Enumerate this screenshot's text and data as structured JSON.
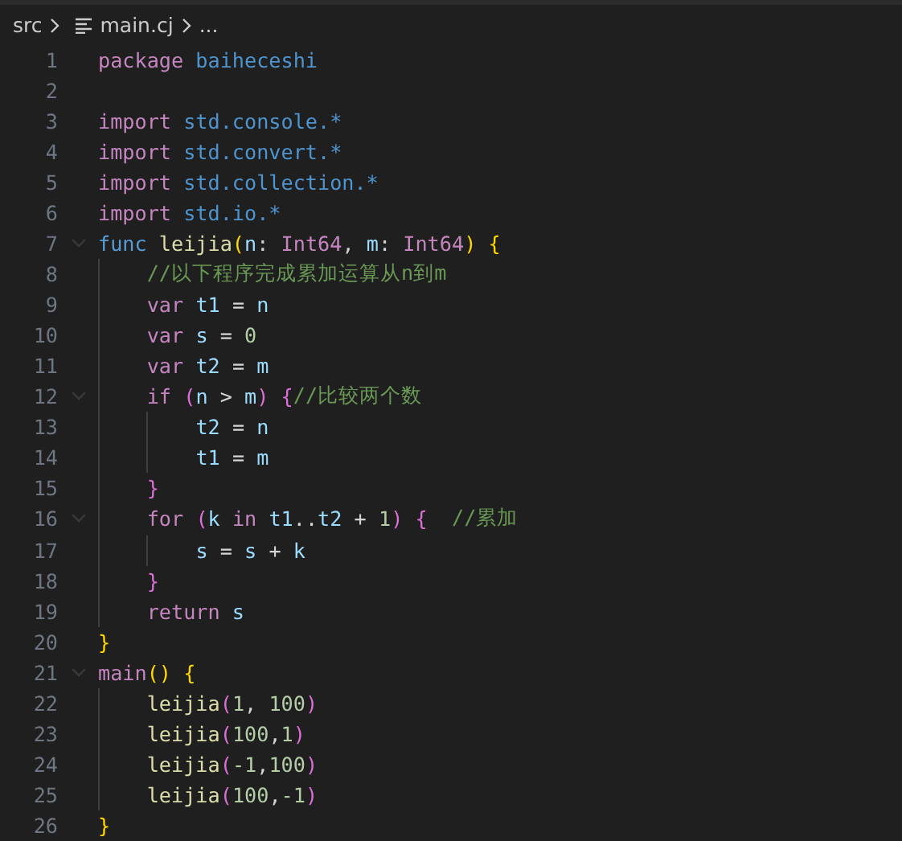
{
  "breadcrumb": {
    "folder": "src",
    "file": "main.cj",
    "more": "..."
  },
  "lines": [
    {
      "number": "1",
      "foldable": false,
      "tokens": [
        {
          "text": "package ",
          "kind": "keyword"
        },
        {
          "text": "baiheceshi",
          "kind": "module"
        }
      ]
    },
    {
      "number": "2",
      "foldable": false
    },
    {
      "number": "3",
      "foldable": false,
      "tokens": [
        {
          "text": "import ",
          "kind": "keyword"
        },
        {
          "text": "std.console.*",
          "kind": "module"
        }
      ]
    },
    {
      "number": "4",
      "foldable": false,
      "tokens": [
        {
          "text": "import ",
          "kind": "keyword"
        },
        {
          "text": "std.convert.*",
          "kind": "module"
        }
      ]
    },
    {
      "number": "5",
      "foldable": false,
      "tokens": [
        {
          "text": "import ",
          "kind": "keyword"
        },
        {
          "text": "std.collection.*",
          "kind": "module"
        }
      ]
    },
    {
      "number": "6",
      "foldable": false,
      "tokens": [
        {
          "text": "import ",
          "kind": "keyword"
        },
        {
          "text": "std.io.*",
          "kind": "module"
        }
      ]
    },
    {
      "number": "7",
      "foldable": true,
      "tokens": [
        {
          "text": "func ",
          "kind": "declaration"
        },
        {
          "text": "leijia",
          "kind": "function"
        },
        {
          "text": "(",
          "kind": "bracket1"
        },
        {
          "text": "n",
          "kind": "variable"
        },
        {
          "text": ": ",
          "kind": "plain"
        },
        {
          "text": "Int64",
          "kind": "type"
        },
        {
          "text": ", ",
          "kind": "plain"
        },
        {
          "text": "m",
          "kind": "variable"
        },
        {
          "text": ": ",
          "kind": "plain"
        },
        {
          "text": "Int64",
          "kind": "type"
        },
        {
          "text": ") {",
          "kind": "bracket1"
        }
      ]
    },
    {
      "number": "8",
      "foldable": false,
      "tokens": [
        {
          "text": "    //以下程序完成累加运算从n到m",
          "kind": "comment"
        }
      ]
    },
    {
      "number": "9",
      "foldable": false,
      "tokens": [
        {
          "text": "    var ",
          "kind": "keyword"
        },
        {
          "text": "t1",
          "kind": "variable"
        },
        {
          "text": " = ",
          "kind": "plain"
        },
        {
          "text": "n",
          "kind": "variable"
        }
      ]
    },
    {
      "number": "10",
      "foldable": false,
      "tokens": [
        {
          "text": "    var ",
          "kind": "keyword"
        },
        {
          "text": "s",
          "kind": "variable"
        },
        {
          "text": " = ",
          "kind": "plain"
        },
        {
          "text": "0",
          "kind": "number"
        }
      ]
    },
    {
      "number": "11",
      "foldable": false,
      "tokens": [
        {
          "text": "    var ",
          "kind": "keyword"
        },
        {
          "text": "t2",
          "kind": "variable"
        },
        {
          "text": " = ",
          "kind": "plain"
        },
        {
          "text": "m",
          "kind": "variable"
        }
      ]
    },
    {
      "number": "12",
      "foldable": true,
      "tokens": [
        {
          "text": "    if ",
          "kind": "keyword"
        },
        {
          "text": "(",
          "kind": "bracket2"
        },
        {
          "text": "n",
          "kind": "variable"
        },
        {
          "text": " > ",
          "kind": "plain"
        },
        {
          "text": "m",
          "kind": "variable"
        },
        {
          "text": ") {",
          "kind": "bracket2"
        },
        {
          "text": "//比较两个数",
          "kind": "comment"
        }
      ]
    },
    {
      "number": "13",
      "foldable": false,
      "tokens": [
        {
          "text": "        t2",
          "kind": "variable"
        },
        {
          "text": " = ",
          "kind": "plain"
        },
        {
          "text": "n",
          "kind": "variable"
        }
      ]
    },
    {
      "number": "14",
      "foldable": false,
      "tokens": [
        {
          "text": "        t1",
          "kind": "variable"
        },
        {
          "text": " = ",
          "kind": "plain"
        },
        {
          "text": "m",
          "kind": "variable"
        }
      ]
    },
    {
      "number": "15",
      "foldable": false,
      "tokens": [
        {
          "text": "    }",
          "kind": "bracket2"
        }
      ]
    },
    {
      "number": "16",
      "foldable": true,
      "tokens": [
        {
          "text": "    for ",
          "kind": "keyword"
        },
        {
          "text": "(",
          "kind": "bracket2"
        },
        {
          "text": "k ",
          "kind": "variable"
        },
        {
          "text": "in ",
          "kind": "keyword"
        },
        {
          "text": "t1",
          "kind": "variable"
        },
        {
          "text": "..",
          "kind": "plain"
        },
        {
          "text": "t2",
          "kind": "variable"
        },
        {
          "text": " + ",
          "kind": "plain"
        },
        {
          "text": "1",
          "kind": "number"
        },
        {
          "text": ") {  ",
          "kind": "bracket2"
        },
        {
          "text": "//累加",
          "kind": "comment"
        }
      ]
    },
    {
      "number": "17",
      "foldable": false,
      "tokens": [
        {
          "text": "        s",
          "kind": "variable"
        },
        {
          "text": " = ",
          "kind": "plain"
        },
        {
          "text": "s",
          "kind": "variable"
        },
        {
          "text": " + ",
          "kind": "plain"
        },
        {
          "text": "k",
          "kind": "variable"
        }
      ]
    },
    {
      "number": "18",
      "foldable": false,
      "tokens": [
        {
          "text": "    }",
          "kind": "bracket2"
        }
      ]
    },
    {
      "number": "19",
      "foldable": false,
      "tokens": [
        {
          "text": "    return ",
          "kind": "keyword"
        },
        {
          "text": "s",
          "kind": "variable"
        }
      ]
    },
    {
      "number": "20",
      "foldable": false,
      "tokens": [
        {
          "text": "}",
          "kind": "bracket1"
        }
      ]
    },
    {
      "number": "21",
      "foldable": true,
      "tokens": [
        {
          "text": "main",
          "kind": "keyword"
        },
        {
          "text": "() {",
          "kind": "bracket1"
        }
      ]
    },
    {
      "number": "22",
      "foldable": false,
      "tokens": [
        {
          "text": "    leijia",
          "kind": "function"
        },
        {
          "text": "(",
          "kind": "bracket2"
        },
        {
          "text": "1",
          "kind": "number"
        },
        {
          "text": ", ",
          "kind": "plain"
        },
        {
          "text": "100",
          "kind": "number"
        },
        {
          "text": ")",
          "kind": "bracket2"
        }
      ]
    },
    {
      "number": "23",
      "foldable": false,
      "tokens": [
        {
          "text": "    leijia",
          "kind": "function"
        },
        {
          "text": "(",
          "kind": "bracket2"
        },
        {
          "text": "100",
          "kind": "number"
        },
        {
          "text": ",",
          "kind": "plain"
        },
        {
          "text": "1",
          "kind": "number"
        },
        {
          "text": ")",
          "kind": "bracket2"
        }
      ]
    },
    {
      "number": "24",
      "foldable": false,
      "tokens": [
        {
          "text": "    leijia",
          "kind": "function"
        },
        {
          "text": "(",
          "kind": "bracket2"
        },
        {
          "text": "-1",
          "kind": "number"
        },
        {
          "text": ",",
          "kind": "plain"
        },
        {
          "text": "100",
          "kind": "number"
        },
        {
          "text": ")",
          "kind": "bracket2"
        }
      ]
    },
    {
      "number": "25",
      "foldable": false,
      "tokens": [
        {
          "text": "    leijia",
          "kind": "function"
        },
        {
          "text": "(",
          "kind": "bracket2"
        },
        {
          "text": "100",
          "kind": "number"
        },
        {
          "text": ",",
          "kind": "plain"
        },
        {
          "text": "-1",
          "kind": "number"
        },
        {
          "text": ")",
          "kind": "bracket2"
        }
      ]
    },
    {
      "number": "26",
      "foldable": false,
      "tokens": [
        {
          "text": "}",
          "kind": "bracket1"
        }
      ]
    }
  ]
}
